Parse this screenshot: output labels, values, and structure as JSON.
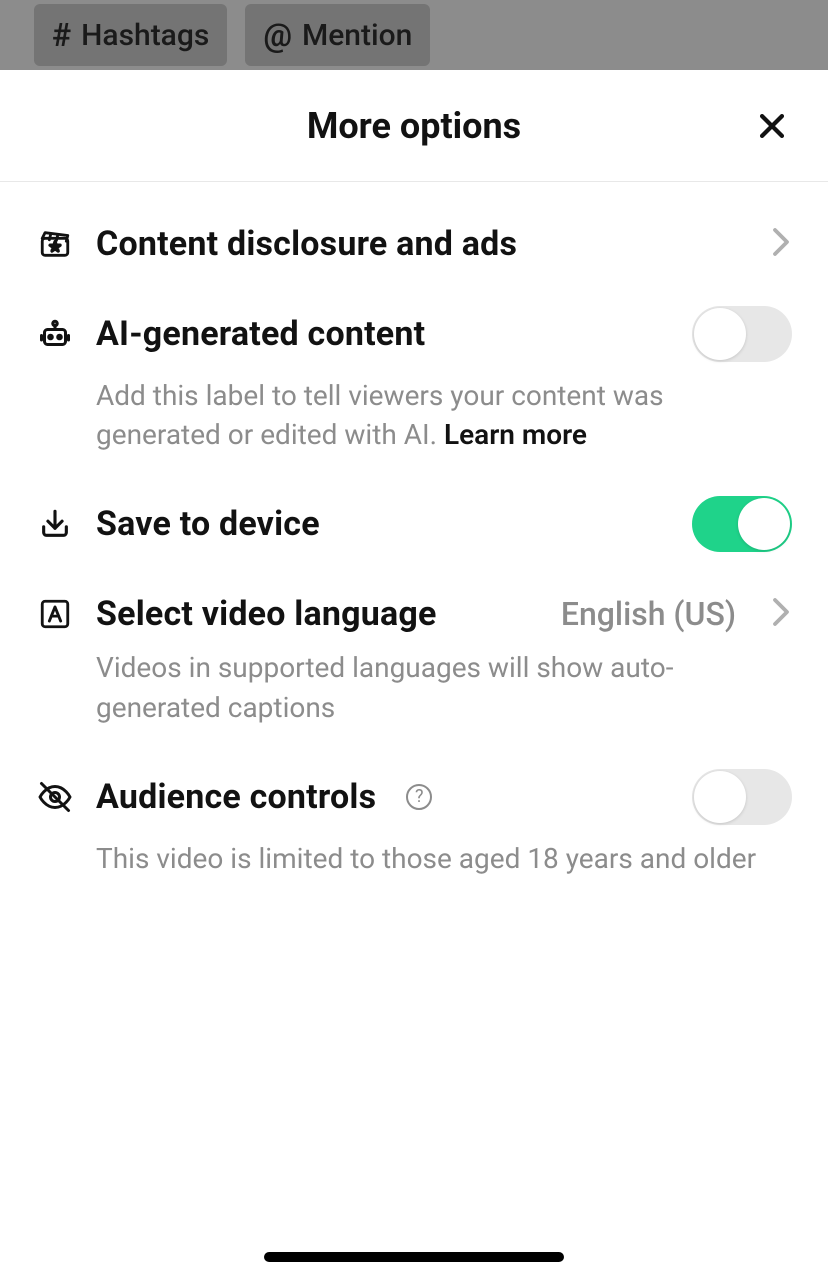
{
  "background": {
    "chips": [
      {
        "symbol": "#",
        "label": "Hashtags"
      },
      {
        "symbol": "@",
        "label": "Mention"
      }
    ]
  },
  "sheet": {
    "title": "More options"
  },
  "rows": {
    "disclosure": {
      "title": "Content disclosure and ads"
    },
    "ai": {
      "title": "AI-generated content",
      "description_prefix": "Add this label to tell viewers your content was generated or edited with AI. ",
      "learn_more": "Learn more",
      "toggle_on": false
    },
    "save": {
      "title": "Save to device",
      "toggle_on": true
    },
    "language": {
      "title": "Select video language",
      "value": "English (US)",
      "description": "Videos in supported languages will show auto-generated captions"
    },
    "audience": {
      "title": "Audience controls",
      "description": "This video is limited to those aged 18 years and older",
      "toggle_on": false
    }
  }
}
